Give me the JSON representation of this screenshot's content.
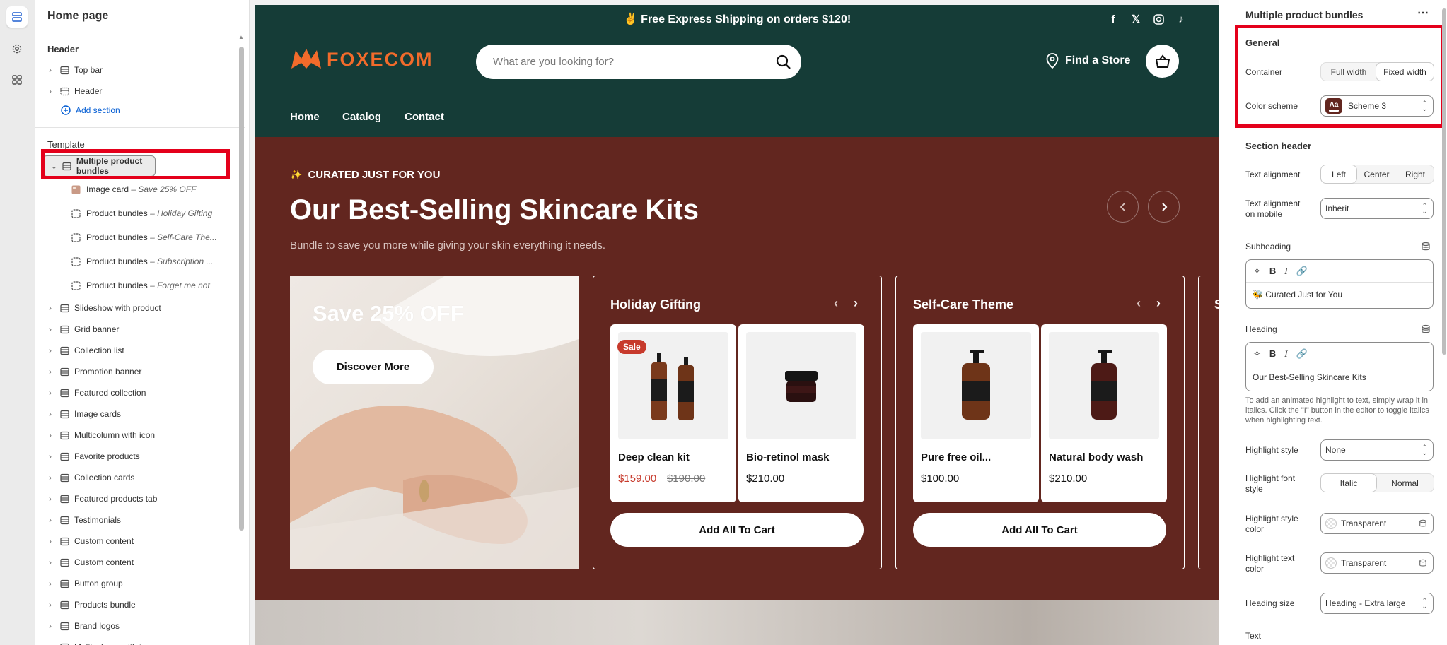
{
  "left": {
    "page_title": "Home page",
    "header_group": "Header",
    "header_items": [
      "Top bar",
      "Header"
    ],
    "add_section": "Add section",
    "template_group": "Template",
    "selected_section": "Multiple product bundles",
    "blocks": [
      {
        "name": "Image card",
        "detail": "Save 25% OFF"
      },
      {
        "name": "Product bundles",
        "detail": "Holiday Gifting"
      },
      {
        "name": "Product bundles",
        "detail": "Self-Care The..."
      },
      {
        "name": "Product bundles",
        "detail": "Subscription ..."
      },
      {
        "name": "Product bundles",
        "detail": "Forget me not"
      }
    ],
    "sections": [
      "Slideshow with product",
      "Grid banner",
      "Collection list",
      "Promotion banner",
      "Featured collection",
      "Image cards",
      "Multicolumn with icon",
      "Favorite products",
      "Collection cards",
      "Featured products tab",
      "Testimonials",
      "Custom content",
      "Custom content",
      "Button group",
      "Products bundle",
      "Brand logos",
      "Multicolumn with icon"
    ]
  },
  "store": {
    "announcement": "✌️ Free Express Shipping on orders $120!",
    "social_icons": [
      "facebook-icon",
      "x-icon",
      "instagram-icon",
      "tiktok-icon"
    ],
    "logo_text": "FOXECOM",
    "search_placeholder": "What are you looking for?",
    "find_store": "Find a Store",
    "menu": [
      "Home",
      "Catalog",
      "Contact"
    ],
    "subheading": "CURATED JUST FOR YOU",
    "heading": "Our Best-Selling Skincare Kits",
    "text": "Bundle to save you more while giving your skin everything it needs.",
    "image_card": {
      "title": "Save 25% OFF",
      "button": "Discover More"
    },
    "bundles": [
      {
        "title": "Holiday Gifting",
        "add_all": "Add All To Cart",
        "products": [
          {
            "name": "Deep clean kit",
            "price": "$159.00",
            "compare": "$190.00",
            "badge": "Sale"
          },
          {
            "name": "Bio-retinol mask",
            "price": "$210.00"
          }
        ]
      },
      {
        "title": "Self-Care Theme",
        "add_all": "Add All To Cart",
        "products": [
          {
            "name": "Pure free oil...",
            "price": "$100.00"
          },
          {
            "name": "Natural body wash",
            "price": "$210.00"
          }
        ]
      }
    ],
    "colors": {
      "announcement_bg": "#153c37",
      "section_bg": "#62261f",
      "accent": "#f26b2b",
      "sale": "#c73a2c"
    }
  },
  "right": {
    "title": "Multiple product bundles",
    "more_icon": "more-horizontal-icon",
    "general": "General",
    "container_label": "Container",
    "container_options": [
      "Full width",
      "Fixed width"
    ],
    "container_selected": "Fixed width",
    "color_scheme_label": "Color scheme",
    "color_scheme_badge": "Aa",
    "color_scheme_value": "Scheme 3",
    "section_header": "Section header",
    "text_alignment_label": "Text alignment",
    "text_alignment_options": [
      "Left",
      "Center",
      "Right"
    ],
    "text_alignment_selected": "Left",
    "text_alignment_mobile_label": "Text alignment on mobile",
    "text_alignment_mobile_value": "Inherit",
    "subheading_label": "Subheading",
    "subheading_value": "🐝 Curated Just for You",
    "heading_label": "Heading",
    "heading_value": "Our Best-Selling Skincare Kits",
    "help_text": "To add an animated highlight to text, simply wrap it in italics. Click the \"I\" button in the editor to toggle italics when highlighting text.",
    "highlight_style_label": "Highlight style",
    "highlight_style_value": "None",
    "highlight_font_style_label": "Highlight font style",
    "highlight_font_style_options": [
      "Italic",
      "Normal"
    ],
    "highlight_font_style_selected": "Italic",
    "highlight_style_color_label": "Highlight style color",
    "highlight_style_color_value": "Transparent",
    "highlight_text_color_label": "Highlight text color",
    "highlight_text_color_value": "Transparent",
    "heading_size_label": "Heading size",
    "heading_size_value": "Heading - Extra large",
    "text_label": "Text"
  }
}
